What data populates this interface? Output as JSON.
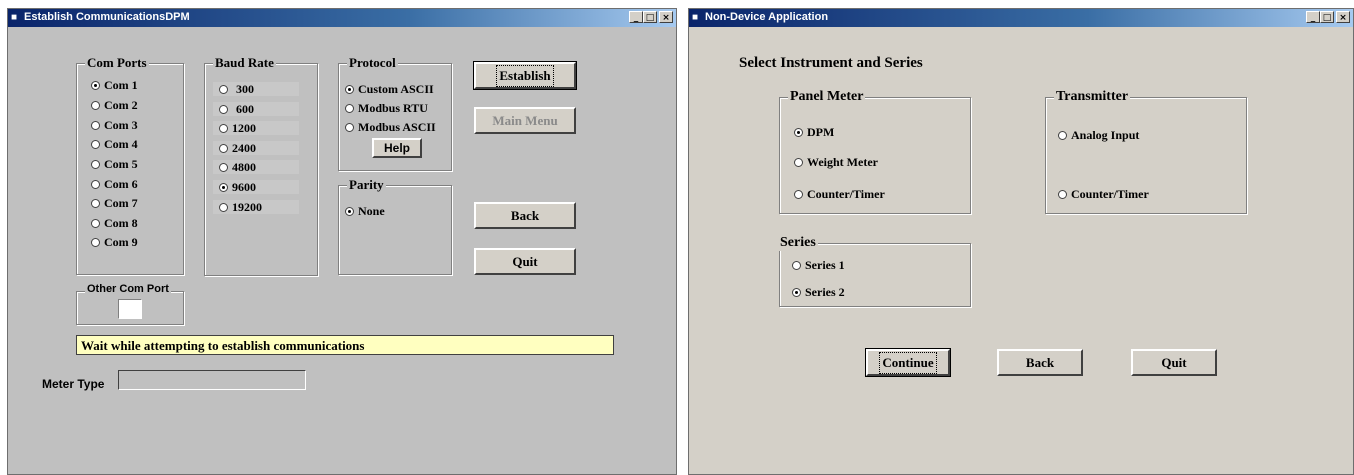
{
  "window1": {
    "title": "Establish CommunicationsDPM",
    "titlebar_buttons": {
      "minimize": "_",
      "maximize": "□",
      "close": "×"
    },
    "com_ports": {
      "title": "Com Ports",
      "items": [
        "Com 1",
        "Com 2",
        "Com 3",
        "Com 4",
        "Com 5",
        "Com 6",
        "Com 7",
        "Com 8",
        "Com 9"
      ],
      "selected": "Com 1"
    },
    "baud_rate": {
      "title": "Baud Rate",
      "items": [
        "300",
        "600",
        "1200",
        "2400",
        "4800",
        "9600",
        "19200"
      ],
      "selected": "9600"
    },
    "protocol": {
      "title": "Protocol",
      "items": [
        "Custom ASCII",
        "Modbus RTU",
        "Modbus ASCII"
      ],
      "selected": "Custom ASCII",
      "help_label": "Help"
    },
    "parity": {
      "title": "Parity",
      "items": [
        "None"
      ],
      "selected": "None"
    },
    "other_com_port": {
      "title": "Other Com Port",
      "value": ""
    },
    "buttons": {
      "establish": "Establish",
      "main_menu": "Main Menu",
      "back": "Back",
      "quit": "Quit"
    },
    "status_message": "Wait while attempting to establish communications",
    "meter_type": {
      "label": "Meter Type",
      "value": ""
    }
  },
  "window2": {
    "title": "Non-Device Application",
    "titlebar_buttons": {
      "minimize": "_",
      "maximize": "□",
      "close": "×"
    },
    "heading": "Select Instrument and Series",
    "panel_meter": {
      "title": "Panel Meter",
      "items": [
        "DPM",
        "Weight Meter",
        "Counter/Timer"
      ],
      "selected": "DPM"
    },
    "transmitter": {
      "title": "Transmitter",
      "items": [
        "Analog Input",
        "Counter/Timer"
      ],
      "selected": ""
    },
    "series": {
      "title": "Series",
      "items": [
        "Series 1",
        "Series 2"
      ],
      "selected": "Series 2"
    },
    "buttons": {
      "continue": "Continue",
      "back": "Back",
      "quit": "Quit"
    }
  },
  "colors": {
    "titlebar": "#0a246a",
    "form_bg_1": "#c0c0c0",
    "form_bg_2": "#d4d0c8",
    "status_bg": "#ffffc0"
  }
}
